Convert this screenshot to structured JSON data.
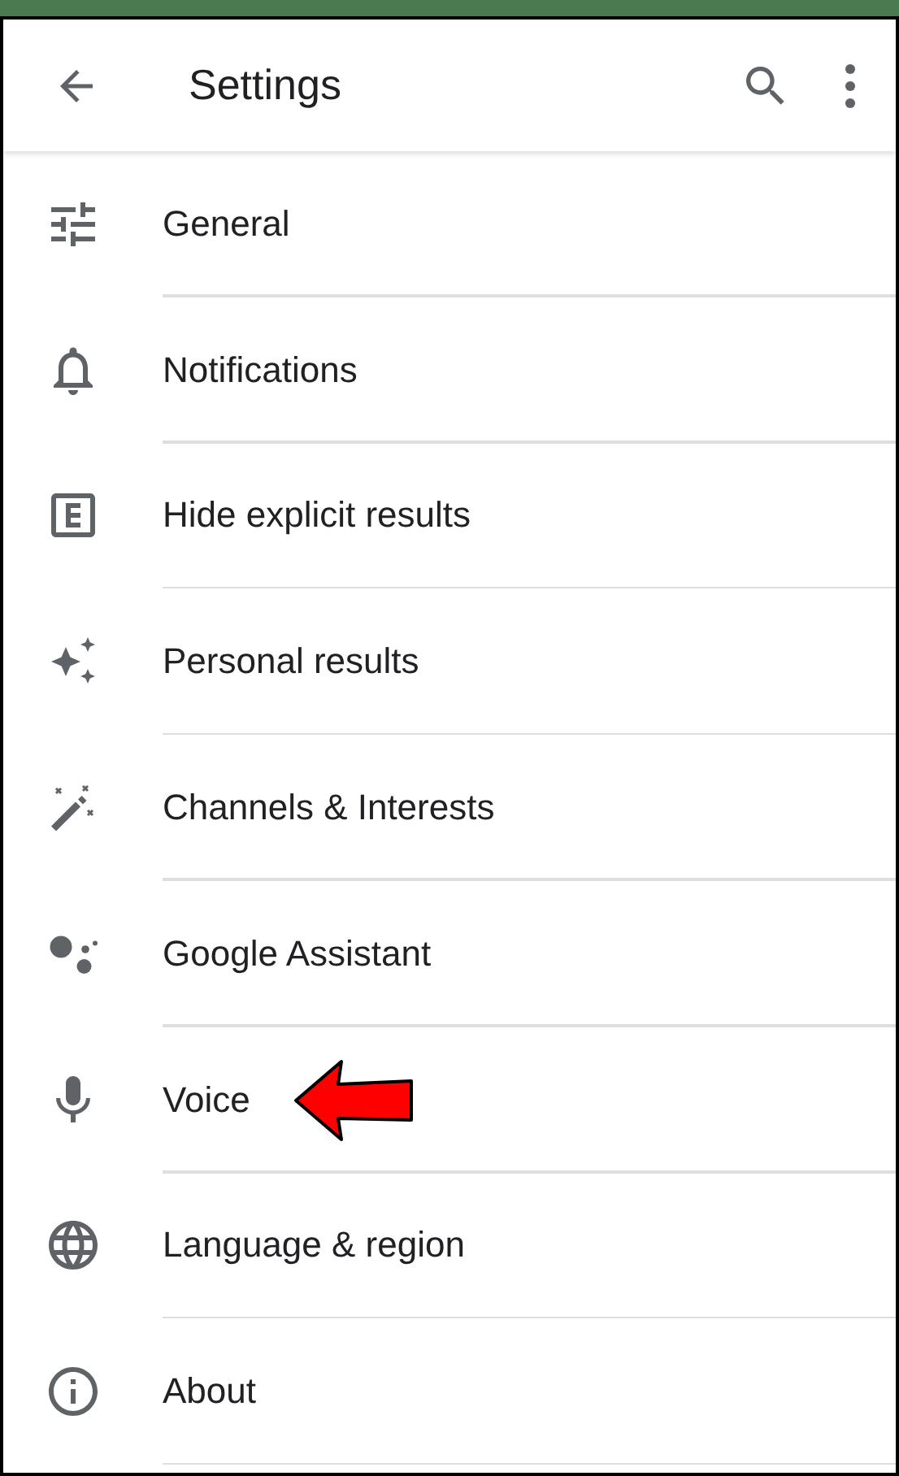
{
  "app_bar": {
    "title": "Settings"
  },
  "items": [
    {
      "label": "General",
      "highlighted": false
    },
    {
      "label": "Notifications",
      "highlighted": false
    },
    {
      "label": "Hide explicit results",
      "highlighted": false
    },
    {
      "label": "Personal results",
      "highlighted": false
    },
    {
      "label": "Channels & Interests",
      "highlighted": false
    },
    {
      "label": "Google Assistant",
      "highlighted": false
    },
    {
      "label": "Voice",
      "highlighted": true
    },
    {
      "label": "Language & region",
      "highlighted": false
    },
    {
      "label": "About",
      "highlighted": false
    }
  ]
}
